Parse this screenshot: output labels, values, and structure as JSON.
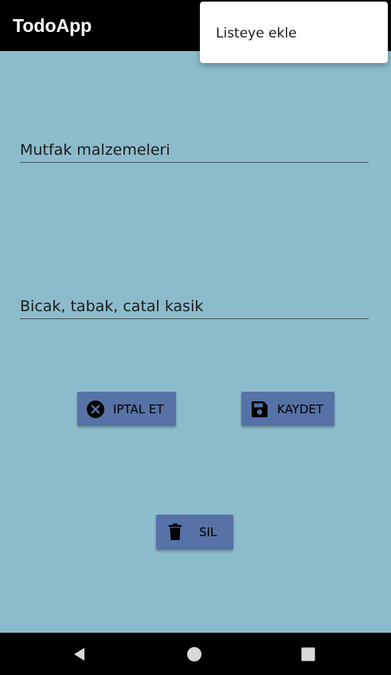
{
  "app_bar": {
    "title": "TodoApp"
  },
  "overflow_menu": {
    "items": [
      {
        "label": "Listeye ekle"
      }
    ]
  },
  "form": {
    "title_field": {
      "value": "Mutfak malzemeleri"
    },
    "description_field": {
      "value": "Bicak, tabak, catal kasik"
    }
  },
  "actions": {
    "cancel_label": "IPTAL ET",
    "save_label": "KAYDET",
    "delete_label": "SIL"
  },
  "icons": {
    "cancel": "cancel-circle-icon",
    "save": "floppy-disk-icon",
    "delete": "trash-icon",
    "nav_back": "back-triangle-icon",
    "nav_home": "home-circle-icon",
    "nav_recents": "recents-square-icon"
  },
  "colors": {
    "background": "#8cbccc",
    "app_bar": "#000000",
    "button": "#5672a6",
    "menu": "#ffffff",
    "nav_bar": "#000000"
  }
}
